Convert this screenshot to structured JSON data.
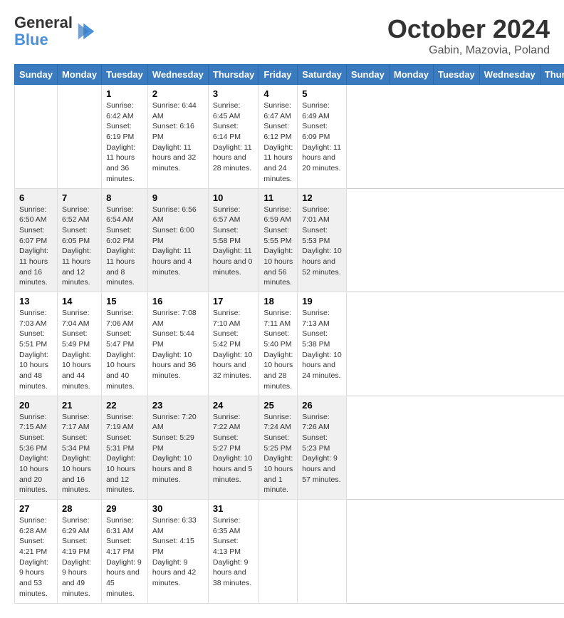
{
  "header": {
    "logo_line1": "General",
    "logo_line2": "Blue",
    "month": "October 2024",
    "location": "Gabin, Mazovia, Poland"
  },
  "days_of_week": [
    "Sunday",
    "Monday",
    "Tuesday",
    "Wednesday",
    "Thursday",
    "Friday",
    "Saturday"
  ],
  "rows": [
    [
      {
        "num": "",
        "sunrise": "",
        "sunset": "",
        "daylight": ""
      },
      {
        "num": "",
        "sunrise": "",
        "sunset": "",
        "daylight": ""
      },
      {
        "num": "1",
        "sunrise": "Sunrise: 6:42 AM",
        "sunset": "Sunset: 6:19 PM",
        "daylight": "Daylight: 11 hours and 36 minutes."
      },
      {
        "num": "2",
        "sunrise": "Sunrise: 6:44 AM",
        "sunset": "Sunset: 6:16 PM",
        "daylight": "Daylight: 11 hours and 32 minutes."
      },
      {
        "num": "3",
        "sunrise": "Sunrise: 6:45 AM",
        "sunset": "Sunset: 6:14 PM",
        "daylight": "Daylight: 11 hours and 28 minutes."
      },
      {
        "num": "4",
        "sunrise": "Sunrise: 6:47 AM",
        "sunset": "Sunset: 6:12 PM",
        "daylight": "Daylight: 11 hours and 24 minutes."
      },
      {
        "num": "5",
        "sunrise": "Sunrise: 6:49 AM",
        "sunset": "Sunset: 6:09 PM",
        "daylight": "Daylight: 11 hours and 20 minutes."
      }
    ],
    [
      {
        "num": "6",
        "sunrise": "Sunrise: 6:50 AM",
        "sunset": "Sunset: 6:07 PM",
        "daylight": "Daylight: 11 hours and 16 minutes."
      },
      {
        "num": "7",
        "sunrise": "Sunrise: 6:52 AM",
        "sunset": "Sunset: 6:05 PM",
        "daylight": "Daylight: 11 hours and 12 minutes."
      },
      {
        "num": "8",
        "sunrise": "Sunrise: 6:54 AM",
        "sunset": "Sunset: 6:02 PM",
        "daylight": "Daylight: 11 hours and 8 minutes."
      },
      {
        "num": "9",
        "sunrise": "Sunrise: 6:56 AM",
        "sunset": "Sunset: 6:00 PM",
        "daylight": "Daylight: 11 hours and 4 minutes."
      },
      {
        "num": "10",
        "sunrise": "Sunrise: 6:57 AM",
        "sunset": "Sunset: 5:58 PM",
        "daylight": "Daylight: 11 hours and 0 minutes."
      },
      {
        "num": "11",
        "sunrise": "Sunrise: 6:59 AM",
        "sunset": "Sunset: 5:55 PM",
        "daylight": "Daylight: 10 hours and 56 minutes."
      },
      {
        "num": "12",
        "sunrise": "Sunrise: 7:01 AM",
        "sunset": "Sunset: 5:53 PM",
        "daylight": "Daylight: 10 hours and 52 minutes."
      }
    ],
    [
      {
        "num": "13",
        "sunrise": "Sunrise: 7:03 AM",
        "sunset": "Sunset: 5:51 PM",
        "daylight": "Daylight: 10 hours and 48 minutes."
      },
      {
        "num": "14",
        "sunrise": "Sunrise: 7:04 AM",
        "sunset": "Sunset: 5:49 PM",
        "daylight": "Daylight: 10 hours and 44 minutes."
      },
      {
        "num": "15",
        "sunrise": "Sunrise: 7:06 AM",
        "sunset": "Sunset: 5:47 PM",
        "daylight": "Daylight: 10 hours and 40 minutes."
      },
      {
        "num": "16",
        "sunrise": "Sunrise: 7:08 AM",
        "sunset": "Sunset: 5:44 PM",
        "daylight": "Daylight: 10 hours and 36 minutes."
      },
      {
        "num": "17",
        "sunrise": "Sunrise: 7:10 AM",
        "sunset": "Sunset: 5:42 PM",
        "daylight": "Daylight: 10 hours and 32 minutes."
      },
      {
        "num": "18",
        "sunrise": "Sunrise: 7:11 AM",
        "sunset": "Sunset: 5:40 PM",
        "daylight": "Daylight: 10 hours and 28 minutes."
      },
      {
        "num": "19",
        "sunrise": "Sunrise: 7:13 AM",
        "sunset": "Sunset: 5:38 PM",
        "daylight": "Daylight: 10 hours and 24 minutes."
      }
    ],
    [
      {
        "num": "20",
        "sunrise": "Sunrise: 7:15 AM",
        "sunset": "Sunset: 5:36 PM",
        "daylight": "Daylight: 10 hours and 20 minutes."
      },
      {
        "num": "21",
        "sunrise": "Sunrise: 7:17 AM",
        "sunset": "Sunset: 5:34 PM",
        "daylight": "Daylight: 10 hours and 16 minutes."
      },
      {
        "num": "22",
        "sunrise": "Sunrise: 7:19 AM",
        "sunset": "Sunset: 5:31 PM",
        "daylight": "Daylight: 10 hours and 12 minutes."
      },
      {
        "num": "23",
        "sunrise": "Sunrise: 7:20 AM",
        "sunset": "Sunset: 5:29 PM",
        "daylight": "Daylight: 10 hours and 8 minutes."
      },
      {
        "num": "24",
        "sunrise": "Sunrise: 7:22 AM",
        "sunset": "Sunset: 5:27 PM",
        "daylight": "Daylight: 10 hours and 5 minutes."
      },
      {
        "num": "25",
        "sunrise": "Sunrise: 7:24 AM",
        "sunset": "Sunset: 5:25 PM",
        "daylight": "Daylight: 10 hours and 1 minute."
      },
      {
        "num": "26",
        "sunrise": "Sunrise: 7:26 AM",
        "sunset": "Sunset: 5:23 PM",
        "daylight": "Daylight: 9 hours and 57 minutes."
      }
    ],
    [
      {
        "num": "27",
        "sunrise": "Sunrise: 6:28 AM",
        "sunset": "Sunset: 4:21 PM",
        "daylight": "Daylight: 9 hours and 53 minutes."
      },
      {
        "num": "28",
        "sunrise": "Sunrise: 6:29 AM",
        "sunset": "Sunset: 4:19 PM",
        "daylight": "Daylight: 9 hours and 49 minutes."
      },
      {
        "num": "29",
        "sunrise": "Sunrise: 6:31 AM",
        "sunset": "Sunset: 4:17 PM",
        "daylight": "Daylight: 9 hours and 45 minutes."
      },
      {
        "num": "30",
        "sunrise": "Sunrise: 6:33 AM",
        "sunset": "Sunset: 4:15 PM",
        "daylight": "Daylight: 9 hours and 42 minutes."
      },
      {
        "num": "31",
        "sunrise": "Sunrise: 6:35 AM",
        "sunset": "Sunset: 4:13 PM",
        "daylight": "Daylight: 9 hours and 38 minutes."
      },
      {
        "num": "",
        "sunrise": "",
        "sunset": "",
        "daylight": ""
      },
      {
        "num": "",
        "sunrise": "",
        "sunset": "",
        "daylight": ""
      }
    ]
  ],
  "row_groups": [
    "row-group-1",
    "row-group-2",
    "row-group-3",
    "row-group-4",
    "row-group-5"
  ]
}
